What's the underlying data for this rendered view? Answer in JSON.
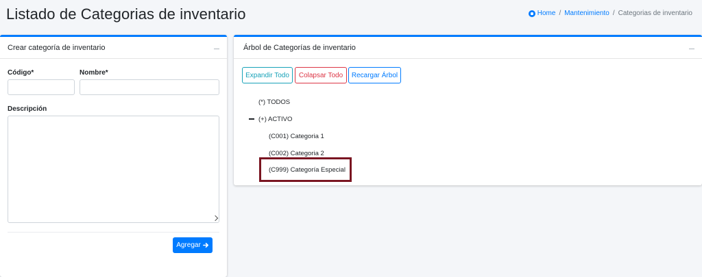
{
  "page": {
    "title": "Listado de Categorias de inventario"
  },
  "breadcrumb": {
    "home": "Home",
    "mantenimiento": "Mantenimiento",
    "current": "Categorias de inventario",
    "separator": "/"
  },
  "create_card": {
    "title": "Crear categoría de inventario",
    "codigo_label": "Código*",
    "codigo_value": "",
    "nombre_label": "Nombre*",
    "nombre_value": "",
    "descripcion_label": "Descripción",
    "descripcion_value": "",
    "submit_label": "Agregar",
    "submit_icon": "arrow-right-icon"
  },
  "tree_card": {
    "title": "Árbol de Categorías de inventario",
    "buttons": {
      "expand": "Expandir Todo",
      "collapse": "Colapsar Todo",
      "reload": "Recargar Árbol"
    },
    "nodes": [
      {
        "label": "(*) TODOS"
      },
      {
        "label": "(+) ACTIVO",
        "expanded": true
      },
      {
        "label": "(C001) Categoria 1"
      },
      {
        "label": "(C002) Categoria 2"
      },
      {
        "label": "(C999) Categoría Especial",
        "highlighted": true
      }
    ]
  },
  "colors": {
    "primary": "#007bff",
    "info": "#17a2b8",
    "danger": "#dc3545",
    "highlight": "#7a1521",
    "background": "#f4f6f9"
  }
}
